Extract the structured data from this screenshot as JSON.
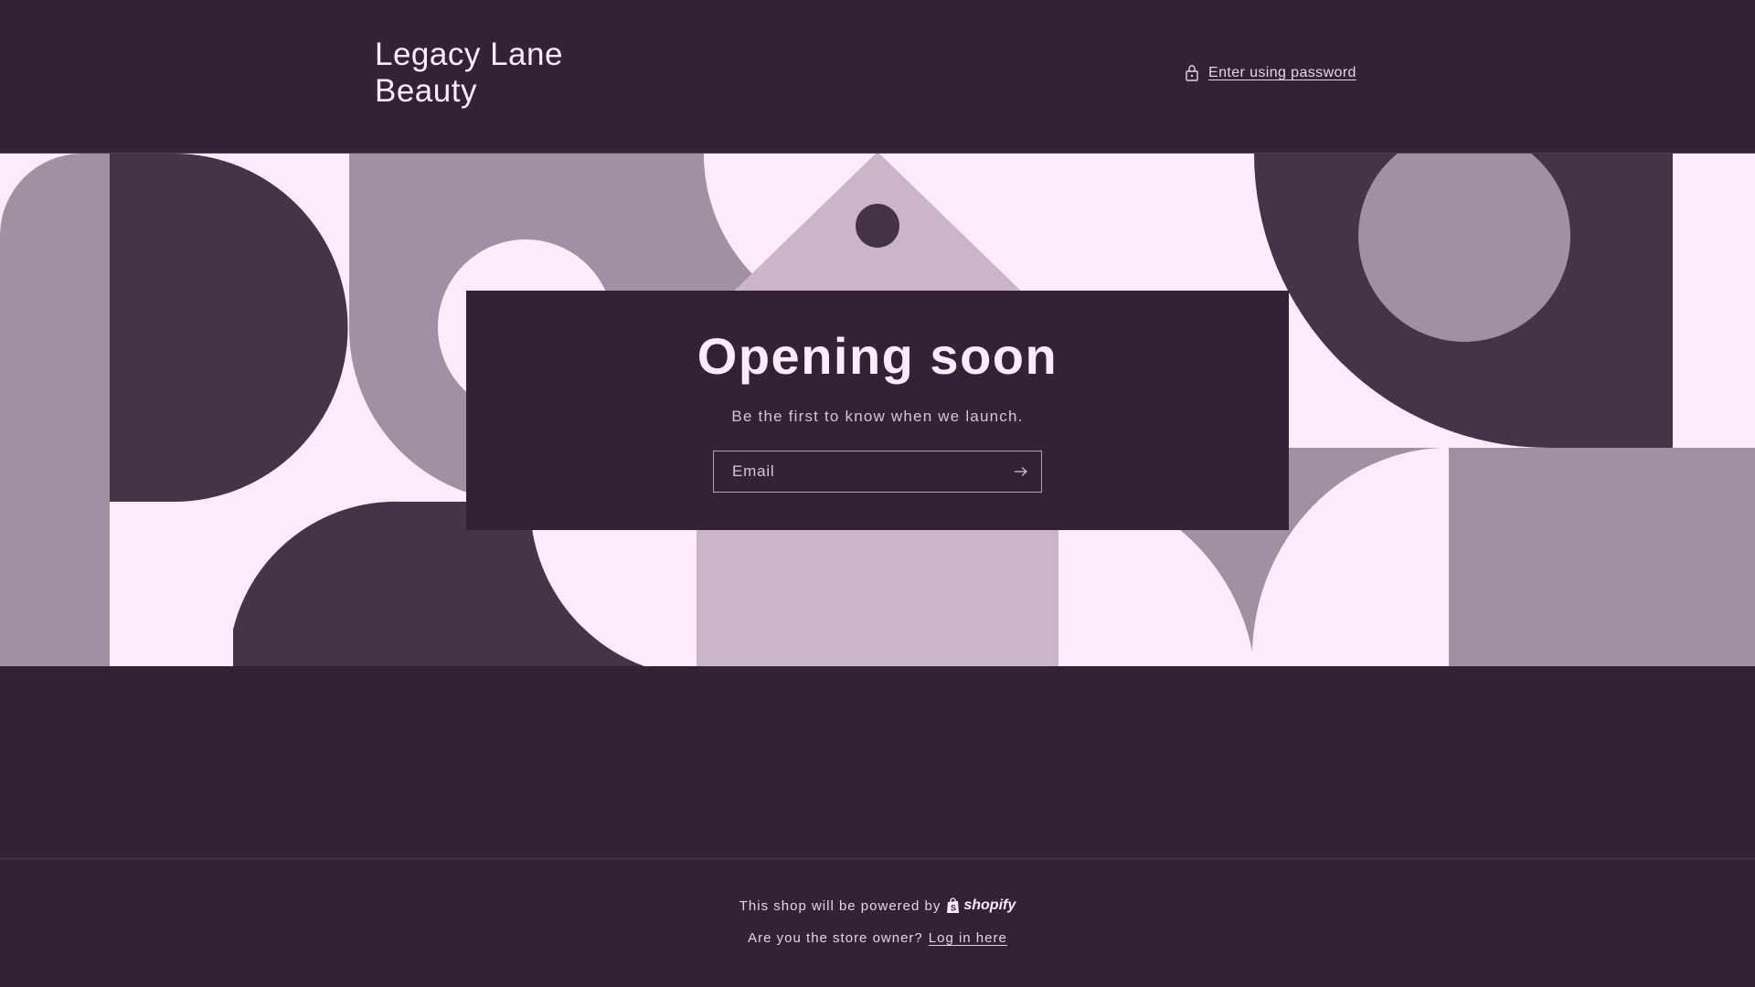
{
  "header": {
    "brand_line1": "Legacy Lane",
    "brand_line2": "Beauty",
    "password_link": "Enter using password"
  },
  "newsletter": {
    "title": "Opening soon",
    "subtitle": "Be the first to know when we launch.",
    "email_placeholder": "Email"
  },
  "footer": {
    "powered_text": "This shop will be powered by",
    "shopify_word": "shopify",
    "owner_question": "Are you the store owner?",
    "login_link": "Log in here"
  },
  "colors": {
    "background": "#332136",
    "banner_light": "#fdebfc",
    "shape_dark": "#473348",
    "shape_mid": "#a38fa2",
    "shape_light": "#cbb6c9"
  },
  "icons": {
    "lock": "lock-icon",
    "submit": "arrow-right-icon",
    "shopify": "shopify-bag-icon"
  }
}
